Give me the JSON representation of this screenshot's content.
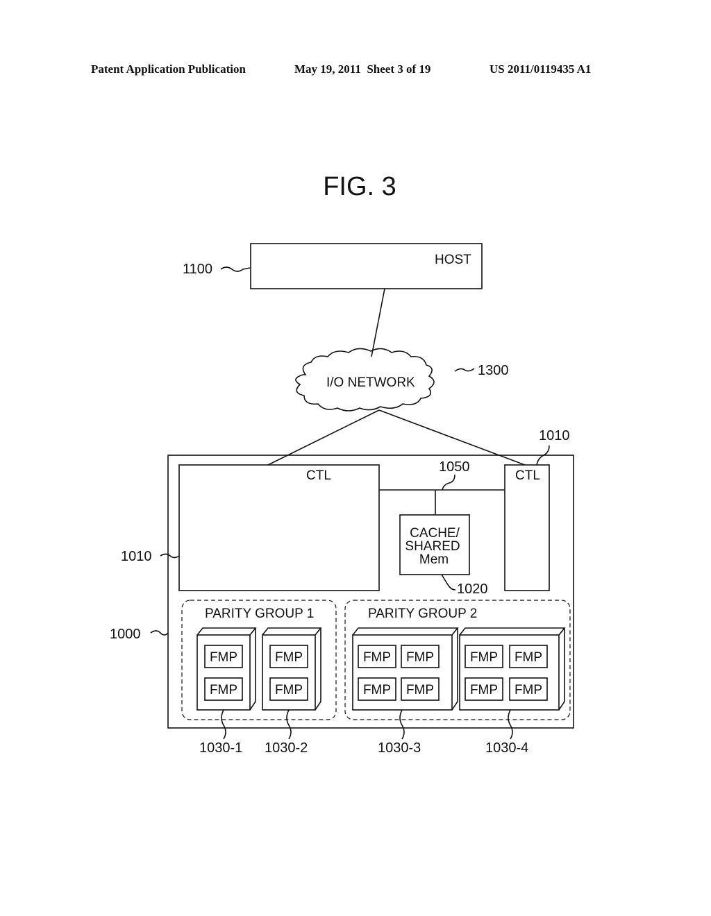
{
  "header": {
    "publication": "Patent Application Publication",
    "date_sheet": "May 19, 2011  Sheet 3 of 19",
    "patent_number": "US 2011/0119435 A1"
  },
  "figure": {
    "title": "FIG. 3",
    "host": {
      "label": "HOST",
      "ref": "1100"
    },
    "network": {
      "label": "I/O NETWORK",
      "ref": "1300"
    },
    "storage": {
      "ref": "1000"
    },
    "ctl_left": {
      "label": "CTL",
      "ref": "1010"
    },
    "ctl_right": {
      "label": "CTL",
      "ref": "1010"
    },
    "bus": {
      "ref": "1050"
    },
    "cache": {
      "line1": "CACHE/",
      "line2": "SHARED",
      "line3": "Mem",
      "ref": "1020"
    },
    "parity_groups": [
      {
        "label": "PARITY GROUP 1"
      },
      {
        "label": "PARITY GROUP 2"
      }
    ],
    "fmp_label": "FMP",
    "drives": [
      {
        "ref": "1030-1"
      },
      {
        "ref": "1030-2"
      },
      {
        "ref": "1030-3"
      },
      {
        "ref": "1030-4"
      }
    ]
  }
}
